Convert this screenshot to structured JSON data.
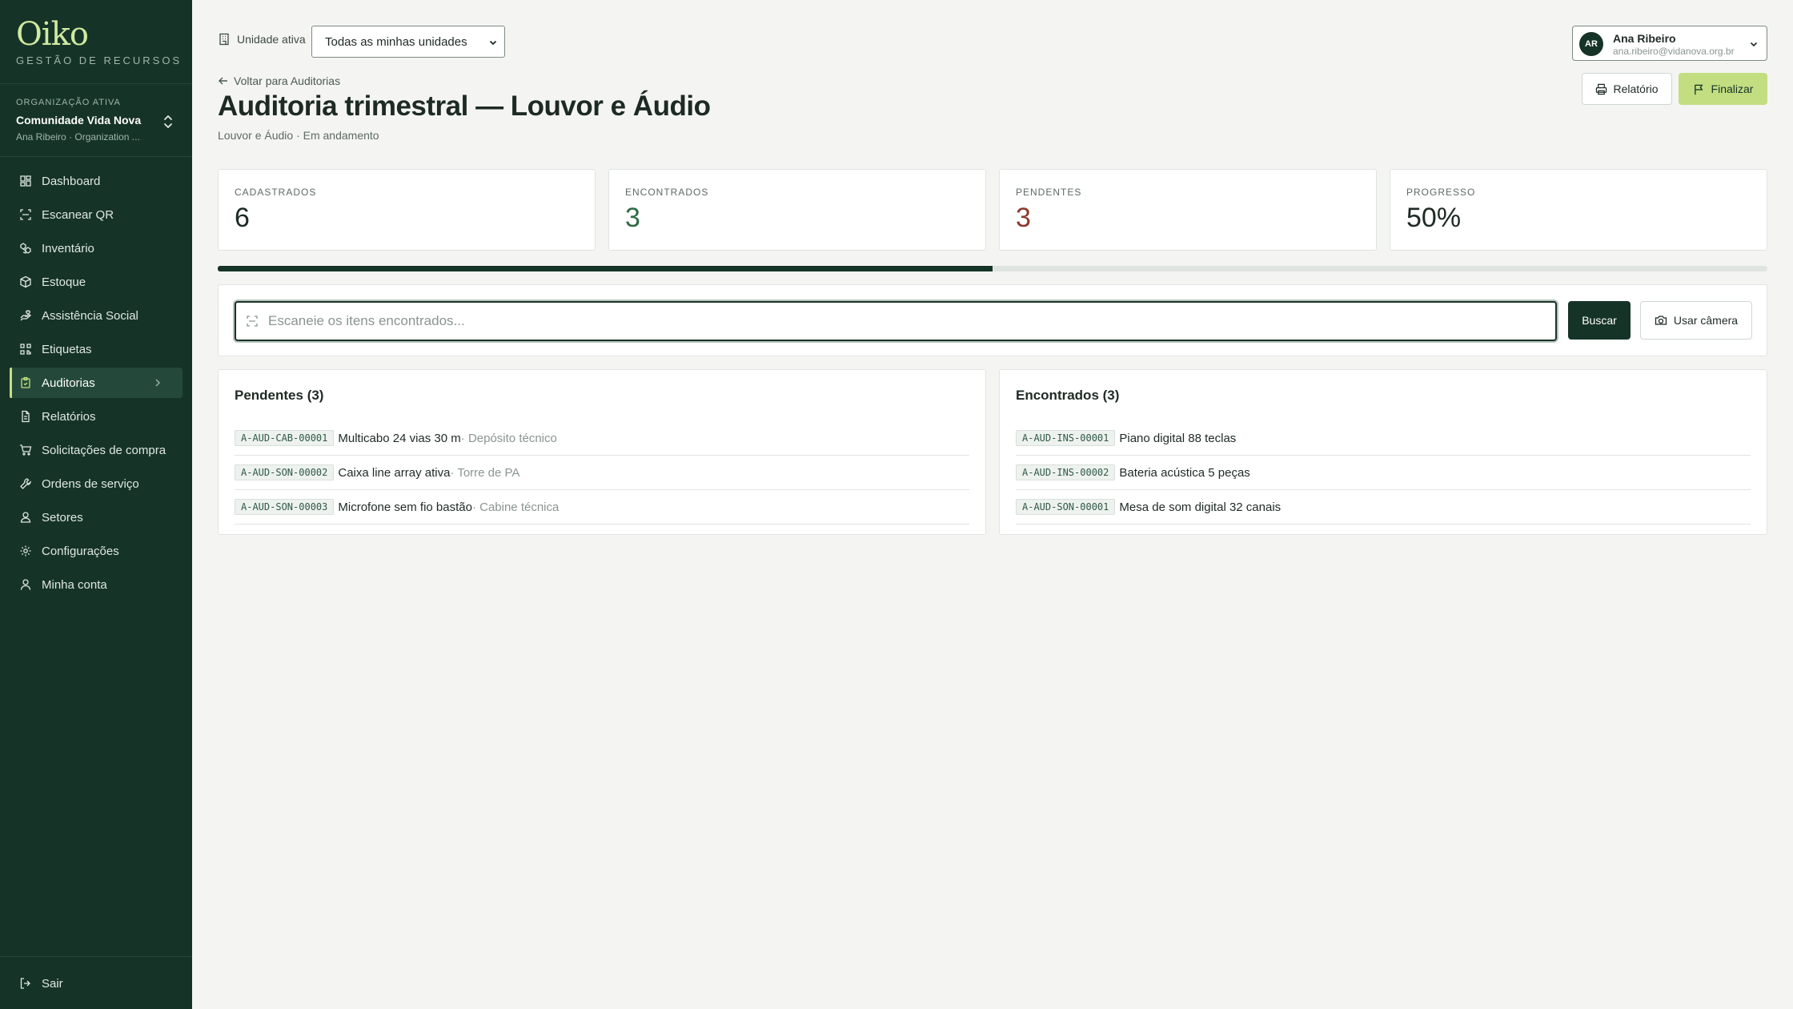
{
  "brand": {
    "logo": "Oiko",
    "subtitle": "GESTÃO DE RECURSOS"
  },
  "org": {
    "label": "ORGANIZAÇÃO ATIVA",
    "name": "Comunidade Vida Nova",
    "user": "Ana Ribeiro · Organization ..."
  },
  "nav": [
    {
      "label": "Dashboard",
      "icon": "grid-icon"
    },
    {
      "label": "Escanear QR",
      "icon": "scan-icon"
    },
    {
      "label": "Inventário",
      "icon": "boxes-icon"
    },
    {
      "label": "Estoque",
      "icon": "package-icon"
    },
    {
      "label": "Assistência Social",
      "icon": "hand-heart-icon"
    },
    {
      "label": "Etiquetas",
      "icon": "qr-icon"
    },
    {
      "label": "Auditorias",
      "icon": "clipboard-check-icon"
    },
    {
      "label": "Relatórios",
      "icon": "document-icon"
    },
    {
      "label": "Solicitações de compra",
      "icon": "cart-icon"
    },
    {
      "label": "Ordens de serviço",
      "icon": "wrench-icon"
    },
    {
      "label": "Setores",
      "icon": "users-icon"
    },
    {
      "label": "Configurações",
      "icon": "gear-icon"
    },
    {
      "label": "Minha conta",
      "icon": "user-icon"
    }
  ],
  "signout": "Sair",
  "topbar": {
    "unit_label": "Unidade ativa",
    "unit_value": "Todas as minhas unidades"
  },
  "user": {
    "initials": "AR",
    "name": "Ana Ribeiro",
    "email": "ana.ribeiro@vidanova.org.br"
  },
  "header": {
    "back": "Voltar para Auditorias",
    "title": "Auditoria trimestral — Louvor e Áudio",
    "subtitle": "Louvor e Áudio · Em andamento",
    "report_label": "Relatório",
    "finish_label": "Finalizar"
  },
  "stats": [
    {
      "label": "CADASTRADOS",
      "value": "6",
      "color": "#1e2a24"
    },
    {
      "label": "ENCONTRADOS",
      "value": "3",
      "color": "#2f6b45"
    },
    {
      "label": "PENDENTES",
      "value": "3",
      "color": "#8a3a2e"
    },
    {
      "label": "PROGRESSO",
      "value": "50%",
      "color": "#1e2a24"
    }
  ],
  "progress": 0.5,
  "scan": {
    "placeholder": "Escaneie os itens encontrados...",
    "search_label": "Buscar",
    "camera_label": "Usar câmera"
  },
  "pending": {
    "title": "Pendentes (3)",
    "items": [
      {
        "code": "A-AUD-CAB-00001",
        "name": "Multicabo 24 vias 30 m",
        "location": " · Depósito técnico"
      },
      {
        "code": "A-AUD-SON-00002",
        "name": "Caixa line array ativa",
        "location": " · Torre de PA"
      },
      {
        "code": "A-AUD-SON-00003",
        "name": "Microfone sem fio bastão",
        "location": " · Cabine técnica"
      }
    ]
  },
  "found": {
    "title": "Encontrados (3)",
    "items": [
      {
        "code": "A-AUD-INS-00001",
        "name": "Piano digital 88 teclas"
      },
      {
        "code": "A-AUD-INS-00002",
        "name": "Bateria acústica 5 peças"
      },
      {
        "code": "A-AUD-SON-00001",
        "name": "Mesa de som digital 32 canais"
      }
    ]
  },
  "colors": {
    "sidebar": "#163328",
    "accent": "#c3de80",
    "primary": "#163328"
  }
}
